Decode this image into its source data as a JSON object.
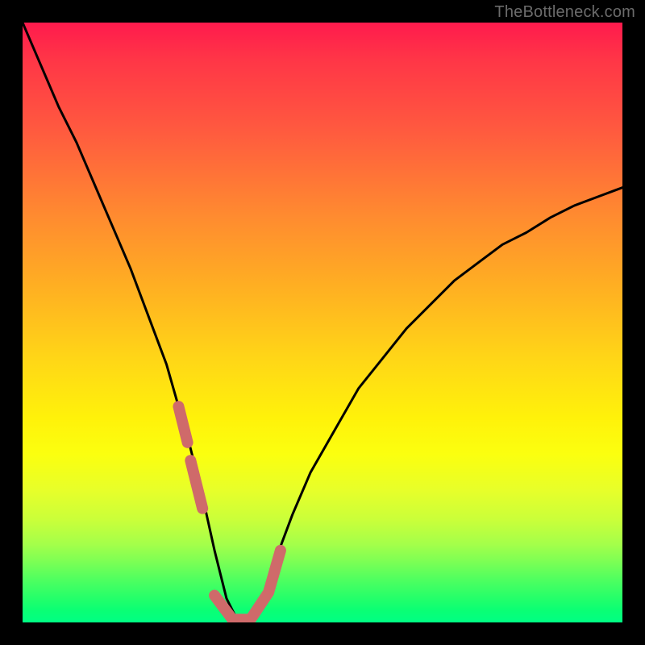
{
  "watermark": {
    "text": "TheBottleneck.com"
  },
  "colors": {
    "curve": "#000000",
    "highlight": "#cf6a6a",
    "background": "#000000"
  },
  "chart_data": {
    "type": "line",
    "title": "",
    "xlabel": "",
    "ylabel": "",
    "xlim": [
      0,
      100
    ],
    "ylim": [
      0,
      100
    ],
    "grid": false,
    "legend": false,
    "series": [
      {
        "name": "bottleneck-curve",
        "x": [
          0,
          3,
          6,
          9,
          12,
          15,
          18,
          21,
          24,
          26,
          28,
          30,
          32,
          34,
          36,
          38,
          40,
          42,
          45,
          48,
          52,
          56,
          60,
          64,
          68,
          72,
          76,
          80,
          84,
          88,
          92,
          96,
          100
        ],
        "y": [
          100,
          93,
          86,
          80,
          73,
          66,
          59,
          51,
          43,
          36,
          29,
          21,
          12,
          4,
          0,
          0,
          4,
          10,
          18,
          25,
          32,
          39,
          44,
          49,
          53,
          57,
          60,
          63,
          65,
          67.5,
          69.5,
          71,
          72.5
        ]
      },
      {
        "name": "highlight-segments",
        "segments": [
          {
            "x": [
              26,
              27.5
            ],
            "y": [
              36,
              30
            ]
          },
          {
            "x": [
              28,
              30
            ],
            "y": [
              27,
              19
            ]
          },
          {
            "x": [
              32,
              35,
              38,
              41,
              43
            ],
            "y": [
              4.5,
              0.5,
              0.5,
              5,
              12
            ]
          }
        ]
      }
    ]
  }
}
